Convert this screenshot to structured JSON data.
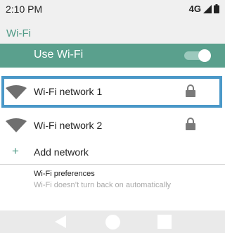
{
  "status_bar": {
    "time": "2:10 PM",
    "network_type": "4G"
  },
  "header": {
    "title": "Wi-Fi"
  },
  "wifi_toggle": {
    "label": "Use Wi-Fi",
    "state": "on"
  },
  "networks": [
    {
      "name": "Wi-Fi network 1",
      "icon": "wifi-signal-icon",
      "secured": true,
      "selected": true
    },
    {
      "name": "Wi-Fi network 2",
      "icon": "wifi-signal-icon",
      "secured": true,
      "selected": false
    }
  ],
  "add_network": {
    "icon": "plus-icon",
    "label": "Add network"
  },
  "preferences": {
    "title": "Wi-Fi preferences",
    "subtitle": "Wi-Fi doesn’t turn back on automatically"
  },
  "nav": {
    "back_icon": "back-icon",
    "home_icon": "home-icon",
    "recents_icon": "recents-icon"
  },
  "colors": {
    "accent": "#5aa08d",
    "title": "#4f9a86",
    "selection_border": "#4a98c8"
  }
}
